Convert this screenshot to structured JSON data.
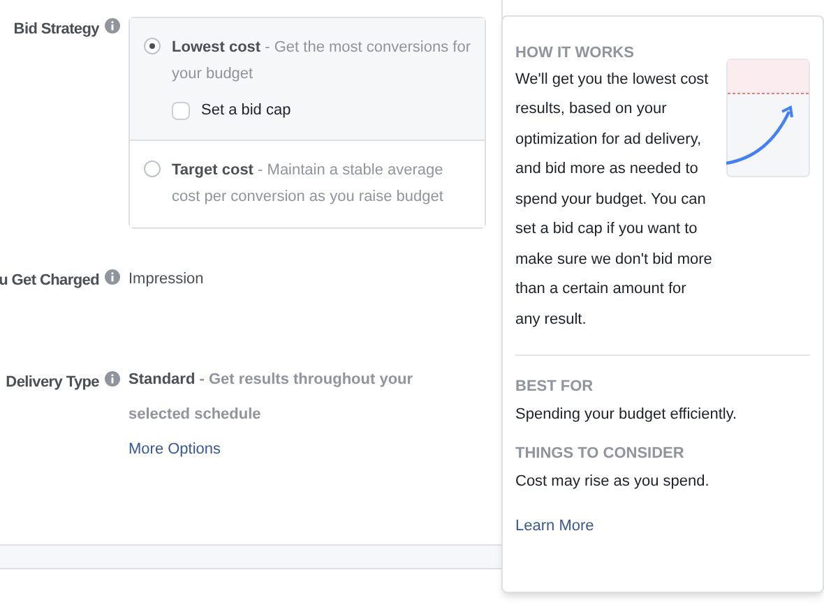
{
  "separator": "-",
  "bid_strategy": {
    "label": "Bid Strategy",
    "options": [
      {
        "title": "Lowest cost",
        "description": "Get the most conversions for your budget",
        "selected": true,
        "bid_cap": {
          "label": "Set a bid cap",
          "checked": false
        }
      },
      {
        "title": "Target cost",
        "description": "Maintain a stable average cost per conversion as you raise budget",
        "selected": false
      }
    ]
  },
  "charged": {
    "label": "u Get Charged",
    "value": "Impression"
  },
  "delivery": {
    "label": "Delivery Type",
    "value_title": "Standard",
    "value_description": "Get results throughout your selected schedule",
    "link": "More Options"
  },
  "popover": {
    "how_title": "HOW IT WORKS",
    "how_text": "We'll get you the lowest cost results, based on your optimization for ad delivery, and bid more as needed to spend your budget. You can set a bid cap if you want to make sure we don't bid more than a certain amount for any result.",
    "best_title": "BEST FOR",
    "best_text": "Spending your budget efficiently.",
    "consider_title": "THINGS TO CONSIDER",
    "consider_text": "Cost may rise as you spend.",
    "link": "Learn More"
  }
}
